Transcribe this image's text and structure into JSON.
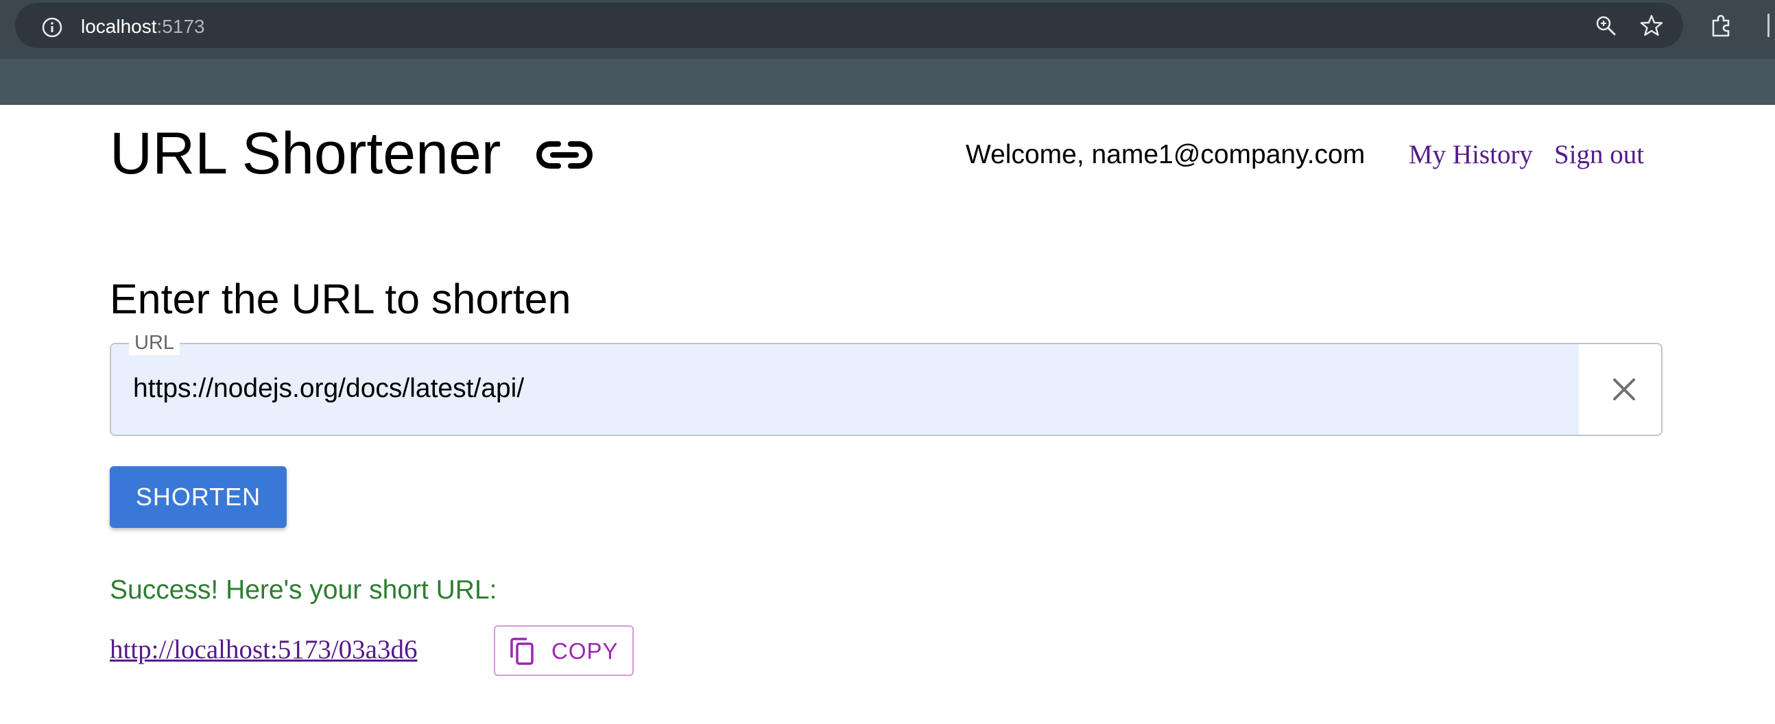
{
  "browser": {
    "url_host": "localhost",
    "url_port": ":5173"
  },
  "header": {
    "title": "URL Shortener",
    "welcome": "Welcome, name1@company.com",
    "my_history_label": "My History",
    "sign_out_label": "Sign out"
  },
  "form": {
    "heading": "Enter the URL to shorten",
    "field_label": "URL",
    "field_value": "https://nodejs.org/docs/latest/api/",
    "shorten_label": "SHORTEN"
  },
  "result": {
    "message": "Success! Here's your short URL:",
    "short_url": "http://localhost:5173/03a3d6",
    "copy_label": "COPY"
  },
  "colors": {
    "accent": "#3a78d8",
    "link": "#551a8b",
    "success": "#2e7d32",
    "copy_accent": "#9c27b0",
    "input_fill": "#e8f0fe"
  },
  "icons": [
    "info-icon",
    "zoom-icon",
    "star-icon",
    "extension-icon",
    "link-icon",
    "close-icon",
    "copy-icon"
  ]
}
